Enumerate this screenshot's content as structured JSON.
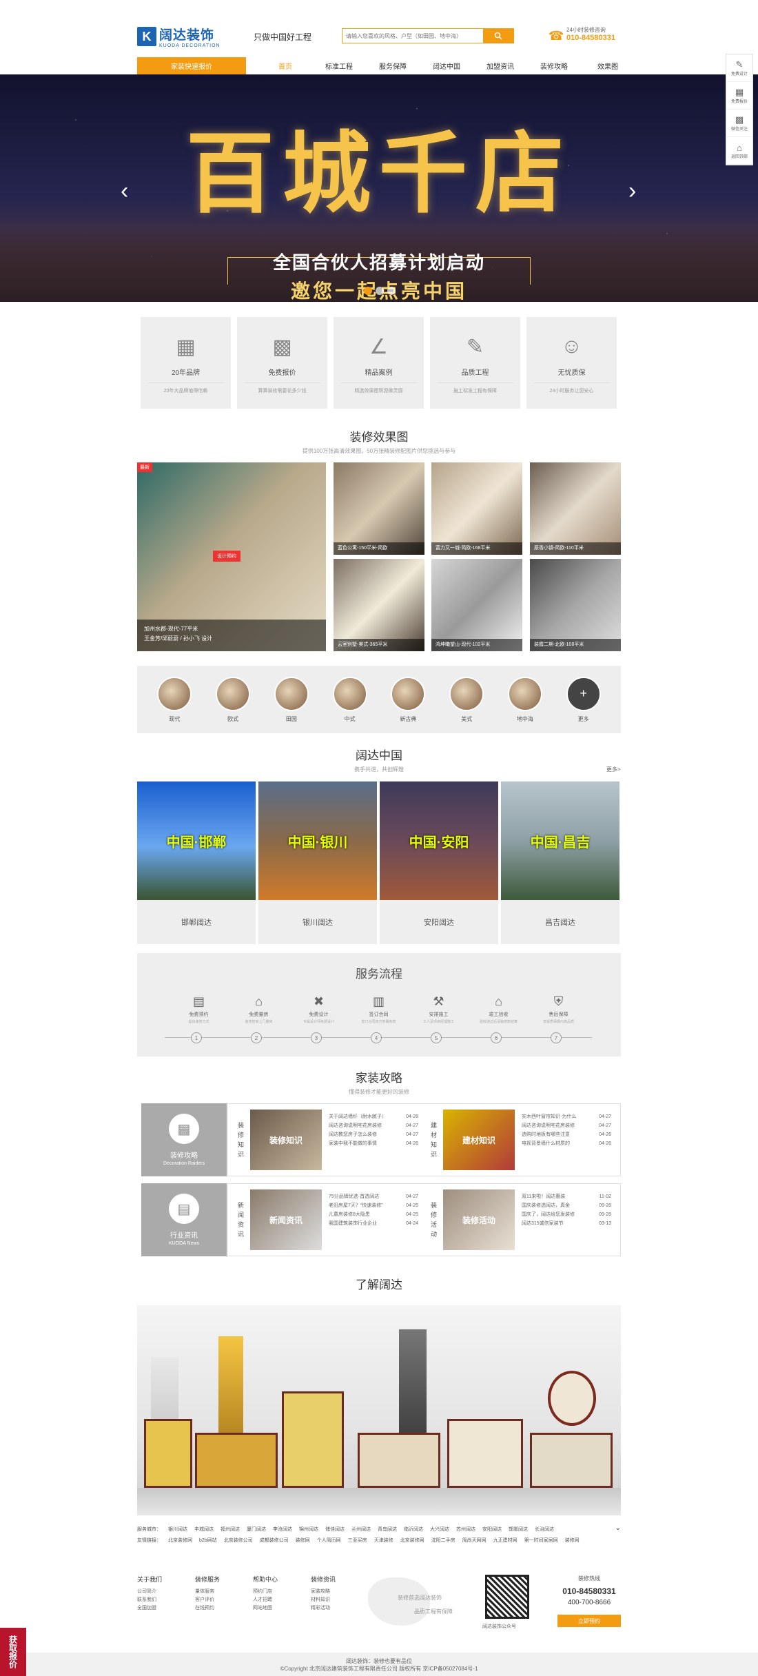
{
  "header": {
    "logo_mark": "K",
    "logo_cn": "阔达装饰",
    "logo_en": "KUODA DECORATION",
    "slogan": "只做中国好工程",
    "search_placeholder": "请输入您喜欢的风格、户型（如田园、地中海）",
    "hotline_label": "24小时装修咨询",
    "hotline_number": "010-84580331"
  },
  "nav": {
    "category": "家装快速报价",
    "items": [
      "首页",
      "标准工程",
      "服务保障",
      "阔达中国",
      "加盟资讯",
      "装修攻略",
      "效果图"
    ]
  },
  "banner": {
    "title": "百城千店",
    "line1": "全国合伙人招募计划启动",
    "line2": "邀您一起点亮中国"
  },
  "right_float": [
    "免费设计",
    "免费报价",
    "微信关注",
    "返回顶部"
  ],
  "features": [
    {
      "icon": "building-icon",
      "title": "20年品牌",
      "desc": "20年大品牌值得信赖"
    },
    {
      "icon": "calculator-icon",
      "title": "免费报价",
      "desc": "算算装修需要花多少钱"
    },
    {
      "icon": "compass-icon",
      "title": "精品案例",
      "desc": "精选效果图帮您做灵感"
    },
    {
      "icon": "pencil-icon",
      "title": "品质工程",
      "desc": "施工标准工程有保障"
    },
    {
      "icon": "worker-icon",
      "title": "无忧质保",
      "desc": "24小时服务让您安心"
    }
  ],
  "gallery": {
    "title": "装修效果图",
    "desc": "提供100万张高清效果图，50万张精装修配图片供您挑选与参与",
    "big": {
      "badge": "最新",
      "tag": "设计预约",
      "line1": "加州水郡-现代-77平米",
      "line2": "王金芳/邱蔚蔚 / 孙小飞 设计"
    },
    "items": [
      "蓝色公寓-150平米-简欧",
      "富力又一城-简欧-168平米",
      "原香小镇-简欧-110平米",
      "云室别墅-美式-365平米",
      "鸿坤曦望山-现代-102平米",
      "装霞二期-北欧-108平米"
    ]
  },
  "styles": [
    "现代",
    "欧式",
    "田园",
    "中式",
    "新古典",
    "美式",
    "地中海",
    "更多"
  ],
  "china": {
    "title": "阔达中国",
    "desc": "携手共进，共创辉煌",
    "more": "更多>",
    "cities": [
      {
        "overlay": "中国·邯郸",
        "label": "邯郸阔达"
      },
      {
        "overlay": "中国·银川",
        "label": "银川阔达"
      },
      {
        "overlay": "中国·安阳",
        "label": "安阳阔达"
      },
      {
        "overlay": "中国·昌吉",
        "label": "昌吉阔达"
      }
    ]
  },
  "service": {
    "title": "服务流程",
    "steps": [
      {
        "name": "免费预约",
        "desc": "提出装修方式"
      },
      {
        "name": "免费量房",
        "desc": "装修管家上门量房"
      },
      {
        "name": "免费设计",
        "desc": "专属设计师免费设计"
      },
      {
        "name": "签订合同",
        "desc": "签订合同双方签署条款"
      },
      {
        "name": "安排施工",
        "desc": "工人及项目经理施工"
      },
      {
        "name": "竣工验收",
        "desc": "验收通过后请装修款结算"
      },
      {
        "name": "售后保障",
        "desc": "享受质保期内高品质"
      }
    ],
    "nums": [
      "1",
      "2",
      "3",
      "4",
      "5",
      "6",
      "7"
    ]
  },
  "guides": {
    "title": "家装攻略",
    "desc": "懂得装修才能更好的装修",
    "boxes": [
      {
        "title": "装修攻略",
        "en": "Decoration Raiders"
      },
      {
        "title": "行业资讯",
        "en": "KUODA News"
      }
    ],
    "cols": [
      {
        "vlabel": "装修知识",
        "img": "装修知识",
        "items": [
          [
            "关于阔达墙纤（耐水腻子）",
            "04-28"
          ],
          [
            "阔达咨询说明宅花房装修",
            "04-27"
          ],
          [
            "阔达教您房子怎么装修",
            "04-27"
          ],
          [
            "家装中我不能做的事情",
            "04-26"
          ]
        ]
      },
      {
        "vlabel": "建材知识",
        "img": "建材知识",
        "items": [
          [
            "实木西叶窗帘知识·为什么",
            "04-27"
          ],
          [
            "阔达咨询说明宅花房装修",
            "04-27"
          ],
          [
            "选购时地板有哪些注意",
            "04-26"
          ],
          [
            "电视背景墙什么材质的",
            "04-26"
          ]
        ]
      },
      {
        "vlabel": "新闻资讯",
        "img": "新闻资讯",
        "items": [
          [
            "75分品牌优选·首选阔达",
            "04-27"
          ],
          [
            "老旧房屋7天？“快速装修”",
            "04-25"
          ],
          [
            "儿童房装修8大隐患",
            "04-25"
          ],
          [
            "我国建筑装饰行业企业",
            "04-24"
          ]
        ]
      },
      {
        "vlabel": "装修活动",
        "img": "装修活动",
        "items": [
          [
            "双11来啦！阔达惠装",
            "11-02"
          ],
          [
            "国庆装修选阔达，真金",
            "09-28"
          ],
          [
            "国庆了，阔达给您发装修",
            "09-28"
          ],
          [
            "阔达315诚信家装节",
            "03-13"
          ]
        ]
      }
    ]
  },
  "about": {
    "title": "了解阔达"
  },
  "links": {
    "cities_label": "服务城市：",
    "cities": [
      "银川阔达",
      "丰城阔达",
      "福州阔达",
      "厦门阔达",
      "李沧阔达",
      "锦州阔达",
      "储佳阔达",
      "兰州阔达",
      "青岛阔达",
      "临沂阔达",
      "大兴阔达",
      "苏州阔达",
      "安阳阔达",
      "邯郸阔达",
      "长治阔达"
    ],
    "friends_label": "友情链接：",
    "friends": [
      "北京装修网",
      "b2b网站",
      "北京装修公司",
      "成都装修公司",
      "装修网",
      "个人简历网",
      "三亚买房",
      "天津装修",
      "北京装修网",
      "沈阳二手房",
      "简尚天网网",
      "九正建材网",
      "第一时间家居网",
      "装修网"
    ]
  },
  "footer": {
    "cols": [
      {
        "title": "关于我们",
        "items": [
          "公司简介",
          "联系我们",
          "全国加盟"
        ]
      },
      {
        "title": "装修服务",
        "items": [
          "量体服务",
          "客户评价",
          "在线预约"
        ]
      },
      {
        "title": "帮助中心",
        "items": [
          "预约门店",
          "人才招聘",
          "网站地图"
        ]
      },
      {
        "title": "装修资讯",
        "items": [
          "家装攻略",
          "材料知识",
          "精彩活动"
        ]
      }
    ],
    "map_t1": "装修首选阔达装饰",
    "map_t2": "品质工程有保障",
    "qr_label": "阔达装饰公众号",
    "hotline_label": "装修热线",
    "hotline1": "010-84580331",
    "hotline2": "400-700-8666",
    "cta": "立即预约",
    "copy1": "阔达装饰：装修也要有品位",
    "copy2": "©Copyright 北京阔达建筑装饰工程有限责任公司 版权所有 京ICP备05027084号-1"
  },
  "float_quote": "获取报价"
}
